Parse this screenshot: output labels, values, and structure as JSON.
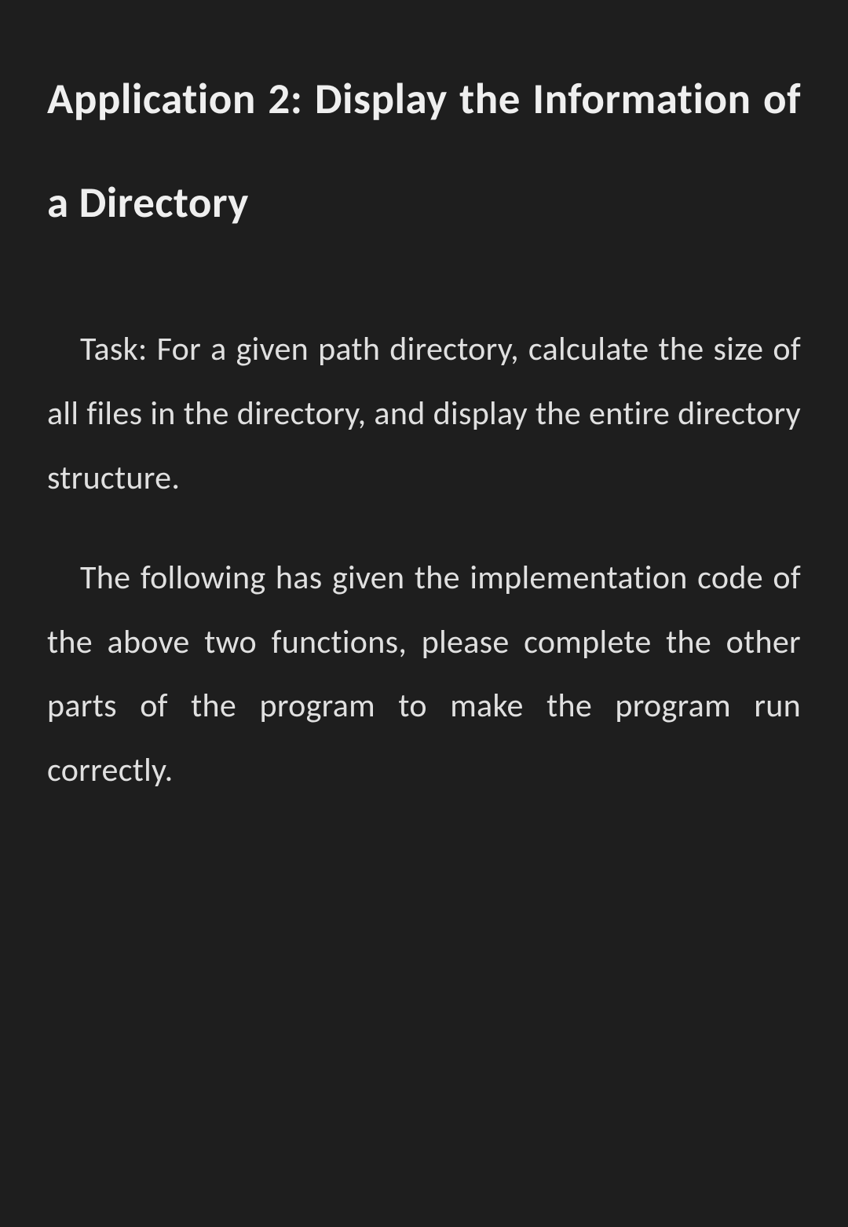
{
  "document": {
    "heading": "Application 2: Display the Information of a Directory",
    "paragraphs": [
      "Task: For a given path directory, calculate the size of all files in the directory, and display the entire directory structure.",
      "The following has given the implementation code of the above two functions, please complete the other parts of the program to make the program run correctly."
    ]
  }
}
